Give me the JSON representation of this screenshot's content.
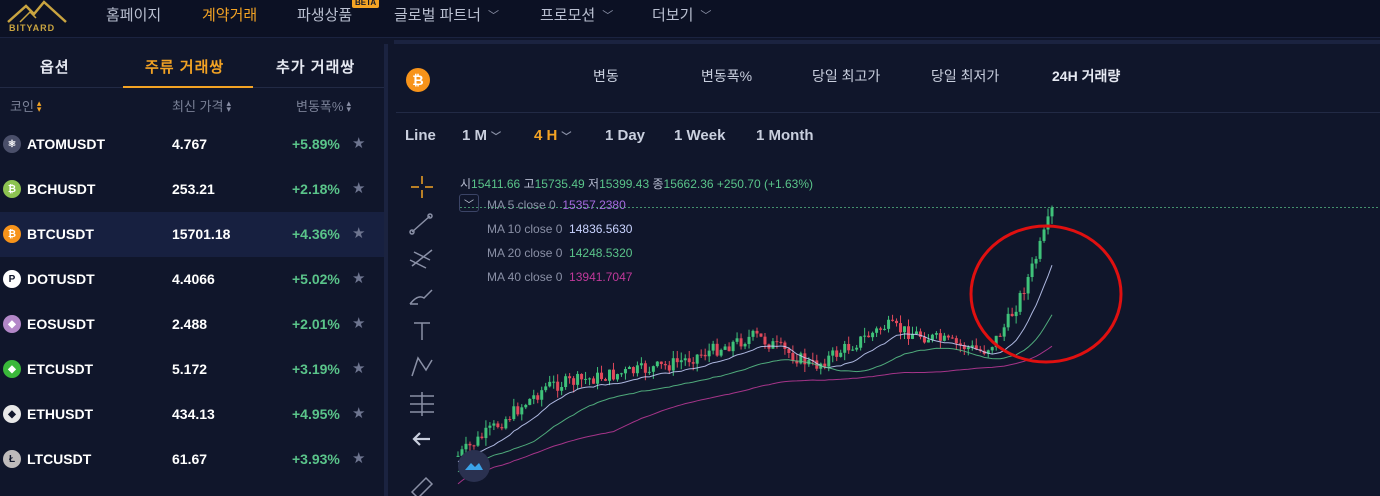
{
  "brand": {
    "name": "BITYARD"
  },
  "nav": {
    "items": [
      {
        "label": "홈페이지",
        "active": false,
        "dropdown": false
      },
      {
        "label": "계약거래",
        "active": true,
        "dropdown": false
      },
      {
        "label": "파생상품",
        "active": false,
        "dropdown": false,
        "badge": "BETA"
      },
      {
        "label": "글로벌 파트너",
        "active": false,
        "dropdown": true
      },
      {
        "label": "프로모션",
        "active": false,
        "dropdown": true
      },
      {
        "label": "더보기",
        "active": false,
        "dropdown": true
      }
    ]
  },
  "market": {
    "tabs": [
      {
        "label": "옵션",
        "active": false
      },
      {
        "label": "주류 거래쌍",
        "active": true
      },
      {
        "label": "추가 거래쌍",
        "active": false
      }
    ],
    "columns": {
      "coin": "코인",
      "price": "최신 가격",
      "change": "변동폭%"
    },
    "rows": [
      {
        "symbol": "ATOMUSDT",
        "price": "4.767",
        "change": "+5.89%",
        "icon": "atom-icon",
        "color": "#4a4f6a",
        "glyph": "⚛",
        "selected": false
      },
      {
        "symbol": "BCHUSDT",
        "price": "253.21",
        "change": "+2.18%",
        "icon": "bch-icon",
        "color": "#8dc351",
        "glyph": "₿",
        "selected": false
      },
      {
        "symbol": "BTCUSDT",
        "price": "15701.18",
        "change": "+4.36%",
        "icon": "btc-icon",
        "color": "#f7931a",
        "glyph": "₿",
        "selected": true
      },
      {
        "symbol": "DOTUSDT",
        "price": "4.4066",
        "change": "+5.02%",
        "icon": "dot-icon",
        "color": "#ffffff",
        "glyph": "P",
        "selected": false
      },
      {
        "symbol": "EOSUSDT",
        "price": "2.488",
        "change": "+2.01%",
        "icon": "eos-icon",
        "color": "#b387c8",
        "glyph": "◆",
        "selected": false
      },
      {
        "symbol": "ETCUSDT",
        "price": "5.172",
        "change": "+3.19%",
        "icon": "etc-icon",
        "color": "#3ab83a",
        "glyph": "◆",
        "selected": false
      },
      {
        "symbol": "ETHUSDT",
        "price": "434.13",
        "change": "+4.95%",
        "icon": "eth-icon",
        "color": "#e8e8e8",
        "glyph": "◆",
        "selected": false
      },
      {
        "symbol": "LTCUSDT",
        "price": "61.67",
        "change": "+3.93%",
        "icon": "ltc-icon",
        "color": "#bfbbbb",
        "glyph": "Ł",
        "selected": false
      }
    ]
  },
  "stats": {
    "headers": [
      "변동",
      "변동폭%",
      "당일 최고가",
      "당일 최저가",
      "24H 거래량"
    ]
  },
  "timeframes": [
    {
      "label": "Line",
      "active": false,
      "dropdown": false
    },
    {
      "label": "1 M",
      "active": false,
      "dropdown": true
    },
    {
      "label": "4 H",
      "active": true,
      "dropdown": true
    },
    {
      "label": "1 Day",
      "active": false,
      "dropdown": false
    },
    {
      "label": "1 Week",
      "active": false,
      "dropdown": false
    },
    {
      "label": "1 Month",
      "active": false,
      "dropdown": false
    }
  ],
  "ohlc": {
    "open_label": "시",
    "open": "15411.66",
    "high_label": "고",
    "high": "15735.49",
    "low_label": "저",
    "low": "15399.43",
    "close_label": "종",
    "close": "15662.36",
    "change": "+250.70 (+1.63%)"
  },
  "indicators": [
    {
      "label": "MA 5 close 0",
      "value": "15357.2380",
      "color": "#a56be0"
    },
    {
      "label": "MA 10 close 0",
      "value": "14836.5630",
      "color": "#c9d3ff"
    },
    {
      "label": "MA 20 close 0",
      "value": "14248.5320",
      "color": "#5ac48a"
    },
    {
      "label": "MA 40 close 0",
      "value": "13941.7047",
      "color": "#c0399a"
    }
  ],
  "colors": {
    "up": "#3fc27a",
    "down": "#e0485a",
    "accent": "#f3a324",
    "annotation": "#e01010"
  }
}
